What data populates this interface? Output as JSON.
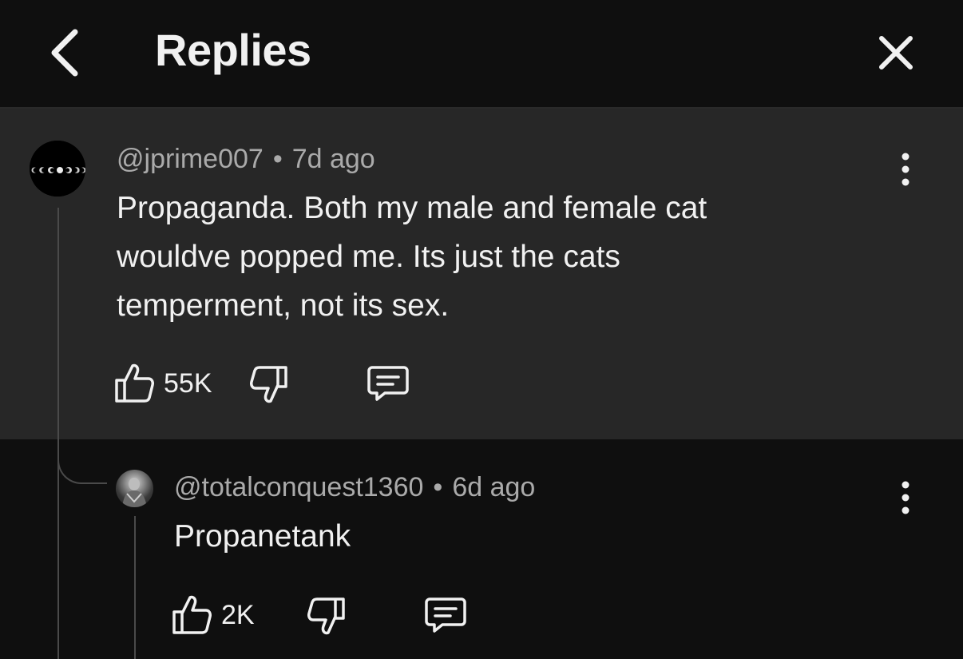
{
  "header": {
    "title": "Replies"
  },
  "parent_comment": {
    "username": "@jprime007",
    "separator": "•",
    "time": "7d ago",
    "text_lines": [
      "Propaganda.  Both my male and female cat",
      "wouldve popped me. Its just the cats",
      "temperment, not its sex."
    ],
    "likes": "55K"
  },
  "reply": {
    "username": "@totalconquest1360",
    "separator": "•",
    "time": "6d ago",
    "text": "Propanetank",
    "likes": "2K"
  },
  "colors": {
    "background": "#0f0f0f",
    "highlight": "#272727",
    "text_primary": "#f1f1f1",
    "text_secondary": "#aaaaaa"
  },
  "icons": [
    "back-chevron-icon",
    "close-icon",
    "thumb-up-icon",
    "thumb-down-icon",
    "reply-comment-icon",
    "more-vertical-icon"
  ]
}
